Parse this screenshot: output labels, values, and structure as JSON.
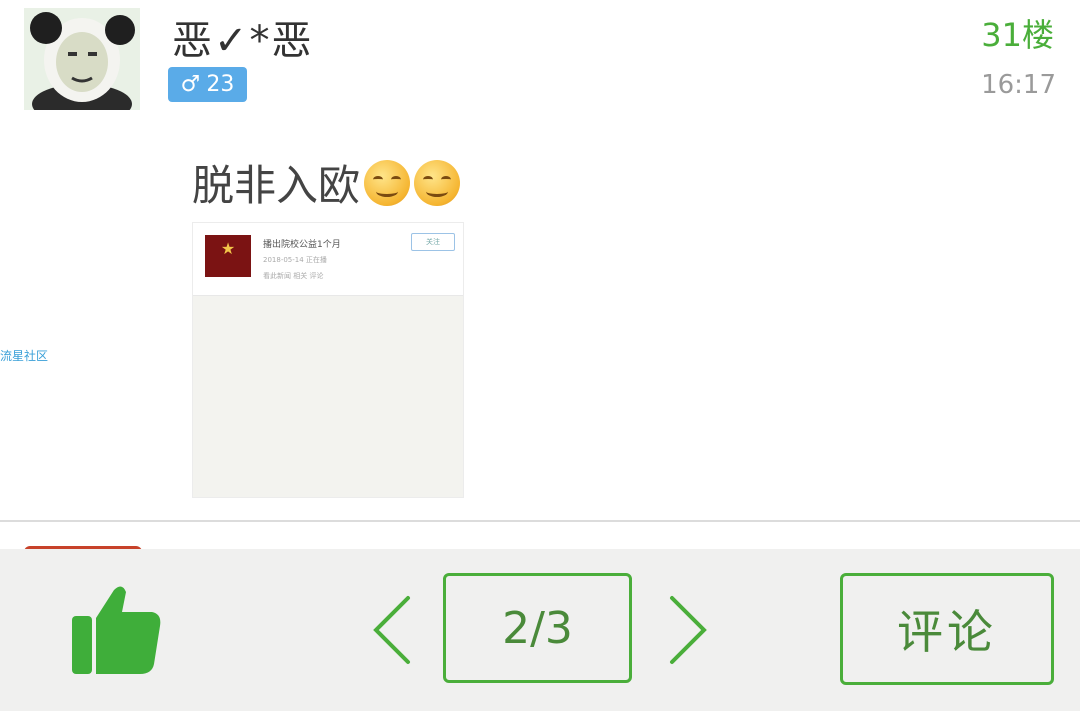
{
  "post": {
    "username": "恶✓*恶",
    "gender_symbol": "♂",
    "age": "23",
    "floor": "31楼",
    "time": "16:17",
    "text": "脱非入欧",
    "emoji_count": 2
  },
  "embedded_screenshot": {
    "title": "播出院校公益1个月",
    "sub1": "2018-05-14 正在播",
    "sub2": "看此新闻  相关  评论",
    "button": "关注"
  },
  "watermark": "流星社区",
  "bottom_bar": {
    "page_indicator": "2/3",
    "comment_label": "评论"
  },
  "colors": {
    "accent_green": "#4aae3a",
    "badge_blue": "#5aabe8"
  },
  "icons": [
    "avatar",
    "male-icon",
    "smile-emoji-icon",
    "thumbs-up-icon",
    "chevron-left-icon",
    "chevron-right-icon"
  ]
}
